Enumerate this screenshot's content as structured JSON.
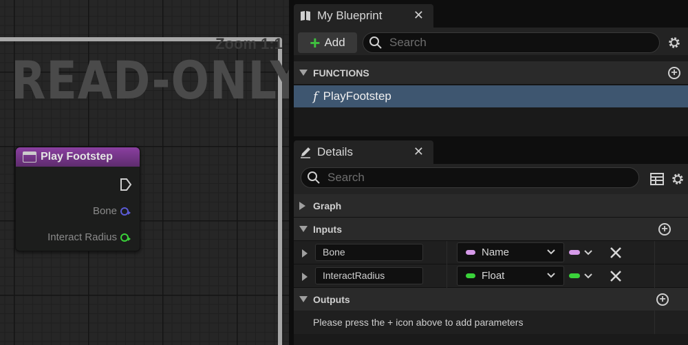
{
  "graph": {
    "zoom_label": "Zoom 1:1",
    "readonly_label": "READ-ONLY",
    "node": {
      "title": "Play Footstep",
      "pins": [
        {
          "label": "Bone",
          "color": "#5b5bd6"
        },
        {
          "label": "Interact Radius",
          "color": "#3ad23a"
        }
      ]
    }
  },
  "my_blueprint": {
    "tab_label": "My Blueprint",
    "close_glyph": "✕",
    "add_label": "Add",
    "search_placeholder": "Search",
    "functions_header": "FUNCTIONS",
    "functions": [
      {
        "glyph": "f",
        "name": "PlayFootstep"
      }
    ]
  },
  "details": {
    "tab_label": "Details",
    "close_glyph": "✕",
    "search_placeholder": "Search",
    "sections": {
      "graph": "Graph",
      "inputs": "Inputs",
      "outputs": "Outputs"
    },
    "inputs": [
      {
        "name": "Bone",
        "type": "Name",
        "color": "#d69ae9"
      },
      {
        "name": "InteractRadius",
        "type": "Float",
        "color": "#3ad23a"
      }
    ],
    "outputs_message": "Please press the + icon above to add parameters"
  },
  "colors": {
    "selected_row": "#3e5670",
    "node_header": "#8a3fa0",
    "add_plus": "#3fc23f"
  }
}
